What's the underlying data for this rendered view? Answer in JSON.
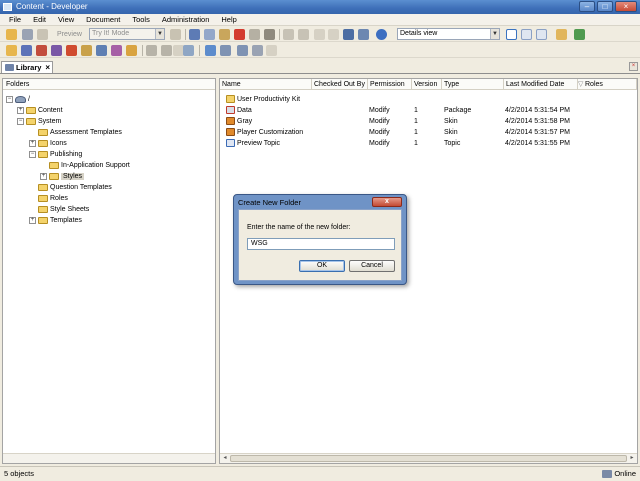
{
  "window": {
    "title": "Content - Developer"
  },
  "menu": [
    "File",
    "Edit",
    "View",
    "Document",
    "Tools",
    "Administration",
    "Help"
  ],
  "toolbar": {
    "preview_label": "Preview",
    "mode_combo": "Try It! Mode",
    "view_combo": "Details view"
  },
  "tab": {
    "label": "Library",
    "close": "×"
  },
  "folders_pane": {
    "header": "Folders",
    "root": "/",
    "items": [
      {
        "label": "Content"
      },
      {
        "label": "System"
      },
      {
        "label": "Assessment Templates"
      },
      {
        "label": "Icons"
      },
      {
        "label": "Publishing"
      },
      {
        "label": "In-Application Support"
      },
      {
        "label": "Styles"
      },
      {
        "label": "Question Templates"
      },
      {
        "label": "Roles"
      },
      {
        "label": "Style Sheets"
      },
      {
        "label": "Templates"
      }
    ]
  },
  "list_pane": {
    "columns": [
      "Name",
      "Checked Out By",
      "Permission",
      "Version",
      "Type",
      "Last Modified Date",
      "Roles"
    ],
    "rows": [
      {
        "name": "User Productivity Kit",
        "checked_out_by": "",
        "permission": "",
        "version": "",
        "type": "",
        "modified": ""
      },
      {
        "name": "Data",
        "checked_out_by": "",
        "permission": "Modify",
        "version": "1",
        "type": "Package",
        "modified": "4/2/2014 5:31:54 PM"
      },
      {
        "name": "Gray",
        "checked_out_by": "",
        "permission": "Modify",
        "version": "1",
        "type": "Skin",
        "modified": "4/2/2014 5:31:58 PM"
      },
      {
        "name": "Player Customization",
        "checked_out_by": "",
        "permission": "Modify",
        "version": "1",
        "type": "Skin",
        "modified": "4/2/2014 5:31:57 PM"
      },
      {
        "name": "Preview Topic",
        "checked_out_by": "",
        "permission": "Modify",
        "version": "1",
        "type": "Topic",
        "modified": "4/2/2014 5:31:55 PM"
      }
    ]
  },
  "dialog": {
    "title": "Create New Folder",
    "close": "x",
    "prompt": "Enter the name of the new folder:",
    "input_value": "WSG",
    "ok": "OK",
    "cancel": "Cancel"
  },
  "status": {
    "objects": "5 objects",
    "connection": "Online"
  },
  "colors": {
    "titlebar": "#3e6fb8",
    "dialog_frame": "#6f93c6",
    "folder": "#f4d36b"
  }
}
